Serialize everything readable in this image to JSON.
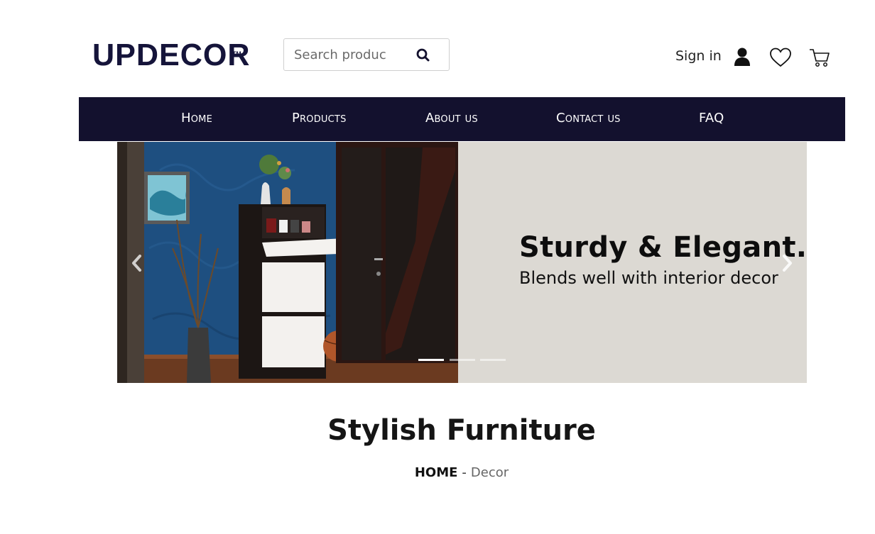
{
  "brand": {
    "logo_text": "UPDECOR",
    "trademark": "TM"
  },
  "search": {
    "placeholder": "Search produc"
  },
  "header": {
    "signin_label": "Sign in"
  },
  "nav": {
    "items": [
      "Home",
      "Products",
      "About us",
      "Contact us",
      "FAQ"
    ]
  },
  "hero": {
    "headline": "Sturdy & Elegant.",
    "subline": "Blends well with interior decor",
    "slide_count": 3,
    "active_slide": 1
  },
  "page": {
    "title": "Stylish Furniture",
    "breadcrumb_home": "HOME",
    "breadcrumb_sep": "-",
    "breadcrumb_current": "Decor"
  },
  "colors": {
    "brand_navy": "#13112e",
    "hero_bg": "#dcd9d3",
    "wall_blue": "#1e4f80"
  },
  "icons": [
    "search-icon",
    "user-icon",
    "heart-icon",
    "cart-icon",
    "chevron-left-icon",
    "chevron-right-icon"
  ]
}
